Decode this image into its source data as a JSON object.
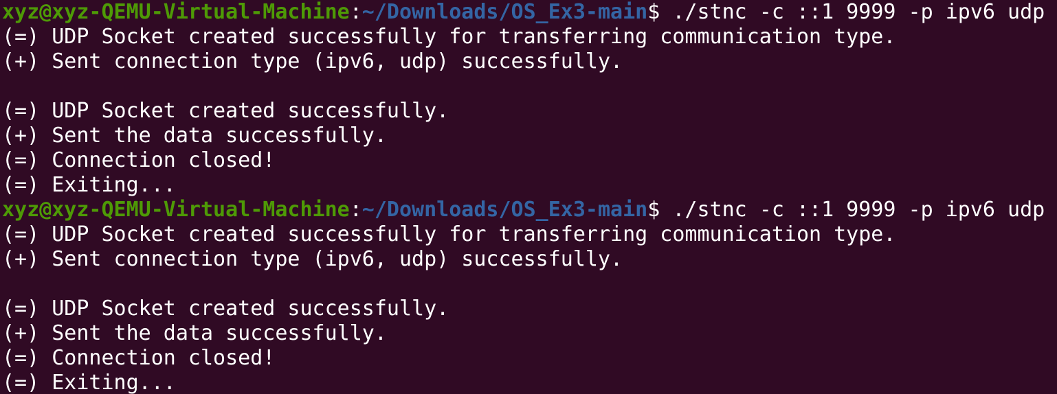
{
  "terminal": {
    "colors": {
      "background": "#300a24",
      "foreground": "#ffffff",
      "prompt_user": "#4e9a06",
      "prompt_path": "#3465a4"
    },
    "sessions": [
      {
        "prompt": {
          "user_host": "xyz@xyz-QEMU-Virtual-Machine",
          "separator": ":",
          "path": "~/Downloads/OS_Ex3-main",
          "symbol": "$ ",
          "command": "./stnc -c ::1 9999 -p ipv6 udp"
        },
        "output": [
          "(=) UDP Socket created successfully for transferring communication type.",
          "(+) Sent connection type (ipv6, udp) successfully.",
          "",
          "(=) UDP Socket created successfully.",
          "(+) Sent the data successfully.",
          "(=) Connection closed!",
          "(=) Exiting..."
        ]
      },
      {
        "prompt": {
          "user_host": "xyz@xyz-QEMU-Virtual-Machine",
          "separator": ":",
          "path": "~/Downloads/OS_Ex3-main",
          "symbol": "$ ",
          "command": "./stnc -c ::1 9999 -p ipv6 udp"
        },
        "output": [
          "(=) UDP Socket created successfully for transferring communication type.",
          "(+) Sent connection type (ipv6, udp) successfully.",
          "",
          "(=) UDP Socket created successfully.",
          "(+) Sent the data successfully.",
          "(=) Connection closed!",
          "(=) Exiting..."
        ]
      }
    ]
  }
}
